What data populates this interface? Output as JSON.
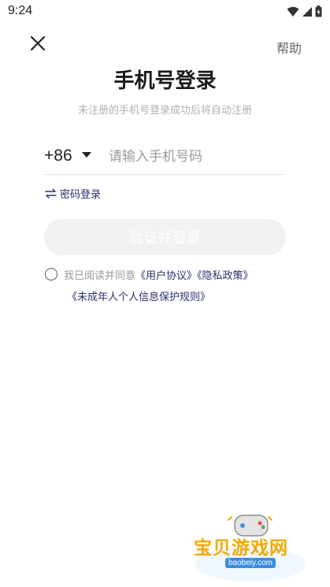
{
  "status_bar": {
    "time": "9:24"
  },
  "header": {
    "help_label": "帮助"
  },
  "login": {
    "title": "手机号登录",
    "subtitle": "未注册的手机号登录成功后将自动注册",
    "country_code": "+86",
    "phone_placeholder": "请输入手机号码",
    "phone_value": "",
    "password_login_label": "密码登录",
    "submit_label": "验证并登录"
  },
  "agreement": {
    "prefix": "我已阅读并同意",
    "user_agreement": "《用户协议》",
    "privacy_policy": "《隐私政策》",
    "minor_protection": "《未成年人个人信息保护规则》"
  },
  "watermark": {
    "name": "宝贝游戏网",
    "url": "baobeiy.com"
  },
  "colors": {
    "accent": "#2a2f6e",
    "button_disabled": "#f1f1f1",
    "watermark": "#f2a800"
  }
}
